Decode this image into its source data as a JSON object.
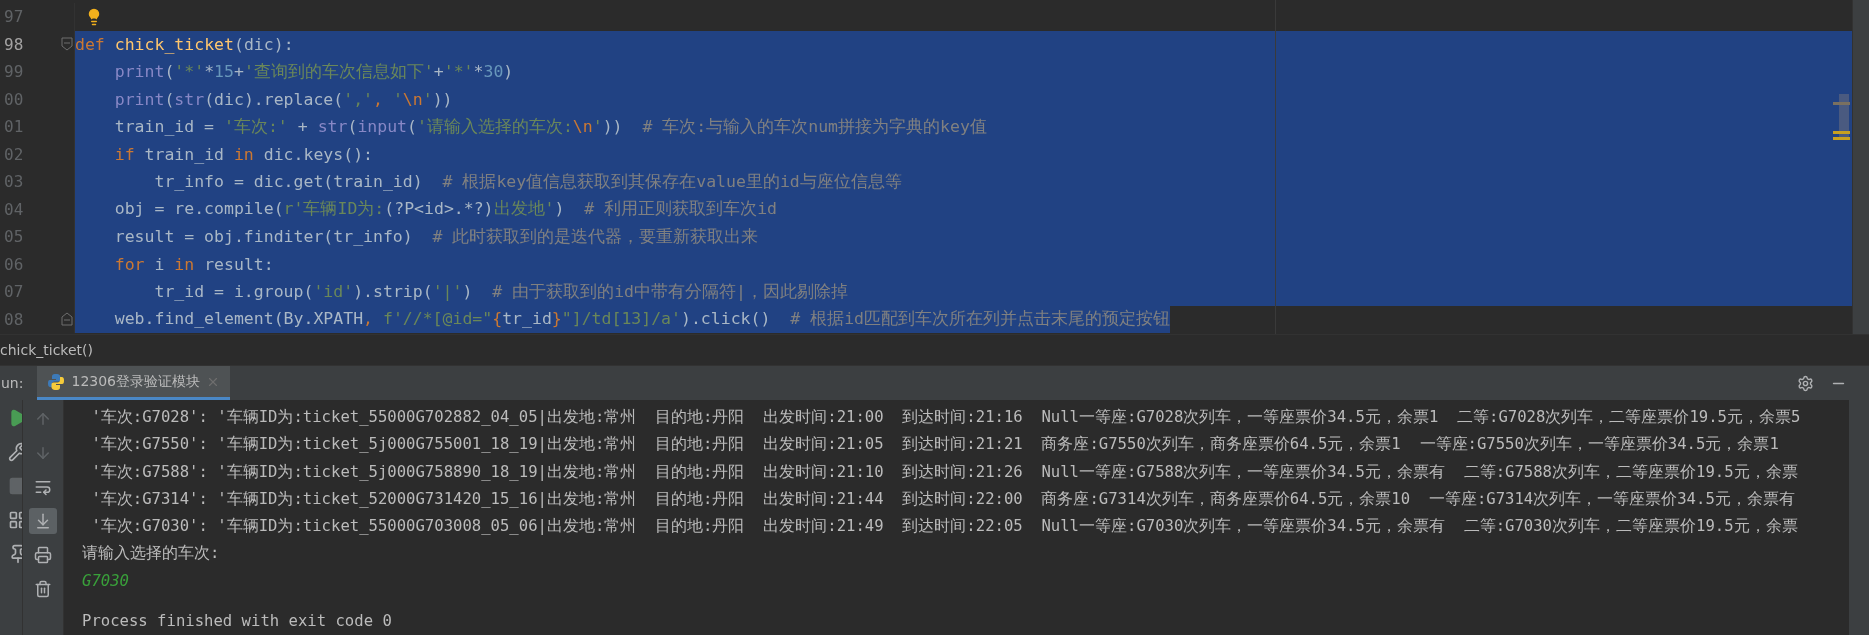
{
  "editor": {
    "lines": [
      {
        "number": "97",
        "current": false,
        "selected": false,
        "bulb": true,
        "fold_start": false,
        "fold_end": false
      },
      {
        "number": "98",
        "current": true,
        "selected": true,
        "bulb": false,
        "fold_start": true,
        "fold_end": false,
        "segments": [
          {
            "kind": "keyword",
            "text": "def "
          },
          {
            "kind": "function",
            "text": "chick_ticket"
          },
          {
            "kind": "plain",
            "text": "(dic):"
          }
        ],
        "children": [
          {
            "number": "99",
            "current": false,
            "selected": true,
            "bulb": false,
            "fold_start": false,
            "fold_end": false,
            "segments": [
              {
                "kind": "builtin",
                "text": "print"
              },
              {
                "kind": "plain",
                "text": "("
              },
              {
                "kind": "string",
                "text": "'*'"
              },
              {
                "kind": "plain",
                "text": "*"
              },
              {
                "kind": "number",
                "text": "15"
              },
              {
                "kind": "plain",
                "text": "+"
              },
              {
                "kind": "string",
                "text": "'查询到的车次信息如下'"
              },
              {
                "kind": "plain",
                "text": "+"
              },
              {
                "kind": "string",
                "text": "'*'"
              },
              {
                "kind": "plain",
                "text": "*"
              },
              {
                "kind": "number",
                "text": "30"
              },
              {
                "kind": "plain",
                "text": ")"
              }
            ]
          },
          {
            "number": "00",
            "current": false,
            "selected": true,
            "bulb": false,
            "fold_start": false,
            "fold_end": false,
            "segments": [
              {
                "kind": "builtin",
                "text": "print"
              },
              {
                "kind": "plain",
                "text": "("
              },
              {
                "kind": "builtin",
                "text": "str"
              },
              {
                "kind": "plain",
                "text": "(dic).replace("
              },
              {
                "kind": "string",
                "text": "','"
              },
              {
                "kind": "keyword",
                "text": ", "
              },
              {
                "kind": "string",
                "text": "'"
              },
              {
                "kind": "keyword",
                "text": "\\n"
              },
              {
                "kind": "string",
                "text": "'"
              },
              {
                "kind": "plain",
                "text": "))"
              }
            ]
          },
          {
            "number": "01",
            "current": false,
            "selected": true,
            "bulb": false,
            "fold_start": false,
            "fold_end": false,
            "segments": [
              {
                "kind": "plain",
                "text": "train_id = "
              },
              {
                "kind": "string",
                "text": "'车次:'"
              },
              {
                "kind": "plain",
                "text": " + "
              },
              {
                "kind": "builtin",
                "text": "str"
              },
              {
                "kind": "plain",
                "text": "("
              },
              {
                "kind": "builtin",
                "text": "input"
              },
              {
                "kind": "plain",
                "text": "("
              },
              {
                "kind": "string",
                "text": "'请输入选择的车次:"
              },
              {
                "kind": "keyword",
                "text": "\\n"
              },
              {
                "kind": "string",
                "text": "'"
              },
              {
                "kind": "plain",
                "text": "))  "
              },
              {
                "kind": "comment",
                "text": "# 车次:与输入的车次num拼接为字典的key值"
              }
            ]
          },
          {
            "number": "02",
            "current": false,
            "selected": true,
            "bulb": false,
            "fold_start": false,
            "fold_end": false,
            "segments": [
              {
                "kind": "keyword",
                "text": "if"
              },
              {
                "kind": "plain",
                "text": " train_id "
              },
              {
                "kind": "keyword",
                "text": "in"
              },
              {
                "kind": "plain",
                "text": " dic.keys():"
              }
            ],
            "children": [
              {
                "number": "03",
                "current": false,
                "selected": true,
                "bulb": false,
                "fold_start": false,
                "fold_end": false,
                "segments": [
                  {
                    "kind": "plain",
                    "text": "tr_info = dic.get(train_id)  "
                  },
                  {
                    "kind": "comment",
                    "text": "# 根据key值信息获取到其保存在value里的id与座位信息等"
                  }
                ]
              }
            ]
          },
          {
            "number": "04",
            "current": false,
            "selected": true,
            "bulb": false,
            "fold_start": false,
            "fold_end": false,
            "segments": [
              {
                "kind": "plain",
                "text": "obj = re.compile("
              },
              {
                "kind": "string",
                "text": "r'车辆ID为:"
              },
              {
                "kind": "plain",
                "text": "(?P<id>.*?)"
              },
              {
                "kind": "string",
                "text": "出发地'"
              },
              {
                "kind": "plain",
                "text": ")  "
              },
              {
                "kind": "comment",
                "text": "# 利用正则获取到车次id"
              }
            ]
          },
          {
            "number": "05",
            "current": false,
            "selected": true,
            "bulb": false,
            "fold_start": false,
            "fold_end": false,
            "segments": [
              {
                "kind": "plain",
                "text": "result = obj.finditer(tr_info)  "
              },
              {
                "kind": "comment",
                "text": "# 此时获取到的是迭代器，要重新获取出来"
              }
            ]
          },
          {
            "number": "06",
            "current": false,
            "selected": true,
            "bulb": false,
            "fold_start": false,
            "fold_end": false,
            "segments": [
              {
                "kind": "keyword",
                "text": "for"
              },
              {
                "kind": "plain",
                "text": " i "
              },
              {
                "kind": "keyword",
                "text": "in"
              },
              {
                "kind": "plain",
                "text": " result:"
              }
            ],
            "children": [
              {
                "number": "07",
                "current": false,
                "selected": true,
                "bulb": false,
                "fold_start": false,
                "fold_end": false,
                "segments": [
                  {
                    "kind": "plain",
                    "text": "tr_id = i.group("
                  },
                  {
                    "kind": "string",
                    "text": "'id'"
                  },
                  {
                    "kind": "plain",
                    "text": ").strip("
                  },
                  {
                    "kind": "string",
                    "text": "'|'"
                  },
                  {
                    "kind": "plain",
                    "text": ")  "
                  },
                  {
                    "kind": "comment",
                    "text": "# 由于获取到的id中带有分隔符|，因此剔除掉"
                  }
                ]
              }
            ]
          },
          {
            "number": "08",
            "current": false,
            "selected": true,
            "bulb": false,
            "fold_start": false,
            "fold_end": true,
            "segments": [
              {
                "kind": "plain",
                "text": "web.find_element(By.XPATH"
              },
              {
                "kind": "keyword",
                "text": ", "
              },
              {
                "kind": "string",
                "text": "f'//*[@id=\""
              },
              {
                "kind": "keyword",
                "text": "{"
              },
              {
                "kind": "plain",
                "text": "tr_id"
              },
              {
                "kind": "keyword",
                "text": "}"
              },
              {
                "kind": "string",
                "text": "\"]/td[13]/a'"
              },
              {
                "kind": "plain",
                "text": ").click()  "
              },
              {
                "kind": "comment",
                "text": "# 根据id匹配到车次所在列并点击末尾的预定按钮"
              }
            ]
          }
        ]
      }
    ]
  },
  "breadcrumb": "chick_ticket()",
  "run_panel": {
    "label": "un:",
    "tab": {
      "title": "12306登录验证模块",
      "selected": true
    },
    "tools": [
      {
        "kind": "up",
        "disabled": true,
        "selected": false
      },
      {
        "kind": "down",
        "disabled": true,
        "selected": false
      },
      {
        "kind": "wrap",
        "disabled": false,
        "selected": false
      },
      {
        "kind": "scroll_end",
        "disabled": false,
        "selected": true
      },
      {
        "kind": "print",
        "disabled": false,
        "selected": false
      },
      {
        "kind": "trash",
        "disabled": false,
        "selected": false
      }
    ],
    "output": [
      {
        "kind": "stdout",
        "text": " '车次:G7028': '车辆ID为:ticket_55000G702882_04_05|出发地:常州  目的地:丹阳  出发时间:21:00  到达时间:21:16  Null一等座:G7028次列车，一等座票价34.5元，余票1  二等:G7028次列车，二等座票价19.5元，余票5"
      },
      {
        "kind": "stdout",
        "text": " '车次:G7550': '车辆ID为:ticket_5j000G755001_18_19|出发地:常州  目的地:丹阳  出发时间:21:05  到达时间:21:21  商务座:G7550次列车，商务座票价64.5元，余票1  一等座:G7550次列车，一等座票价34.5元，余票1"
      },
      {
        "kind": "stdout",
        "text": " '车次:G7588': '车辆ID为:ticket_5j000G758890_18_19|出发地:常州  目的地:丹阳  出发时间:21:10  到达时间:21:26  Null一等座:G7588次列车，一等座票价34.5元，余票有  二等:G7588次列车，二等座票价19.5元，余票"
      },
      {
        "kind": "stdout",
        "text": " '车次:G7314': '车辆ID为:ticket_52000G731420_15_16|出发地:常州  目的地:丹阳  出发时间:21:44  到达时间:22:00  商务座:G7314次列车，商务座票价64.5元，余票10  一等座:G7314次列车，一等座票价34.5元，余票有"
      },
      {
        "kind": "stdout",
        "text": " '车次:G7030': '车辆ID为:ticket_55000G703008_05_06|出发地:常州  目的地:丹阳  出发时间:21:49  到达时间:22:05  Null一等座:G7030次列车，一等座票价34.5元，余票有  二等:G7030次列车，二等座票价19.5元，余票"
      },
      {
        "kind": "stdout",
        "text": "请输入选择的车次:"
      },
      {
        "kind": "input",
        "text": "G7030"
      },
      {
        "kind": "blank"
      },
      {
        "kind": "stdout",
        "text": "Process finished with exit code 0"
      }
    ]
  }
}
